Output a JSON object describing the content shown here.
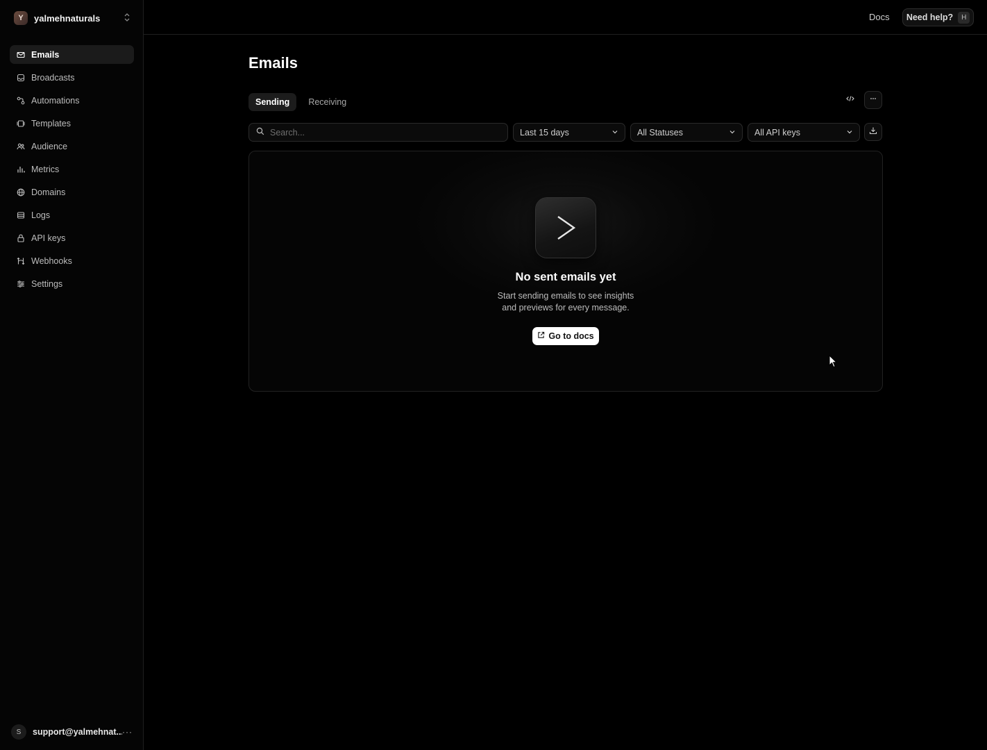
{
  "team": {
    "initial": "Y",
    "name": "yalmehnaturals"
  },
  "sidebar": {
    "items": [
      {
        "label": "Emails",
        "icon": "mail-icon",
        "active": true
      },
      {
        "label": "Broadcasts",
        "icon": "broadcast-icon",
        "active": false
      },
      {
        "label": "Automations",
        "icon": "automation-icon",
        "active": false
      },
      {
        "label": "Templates",
        "icon": "template-icon",
        "active": false
      },
      {
        "label": "Audience",
        "icon": "audience-icon",
        "active": false
      },
      {
        "label": "Metrics",
        "icon": "metrics-icon",
        "active": false
      },
      {
        "label": "Domains",
        "icon": "globe-icon",
        "active": false
      },
      {
        "label": "Logs",
        "icon": "logs-icon",
        "active": false
      },
      {
        "label": "API keys",
        "icon": "lock-icon",
        "active": false
      },
      {
        "label": "Webhooks",
        "icon": "webhook-icon",
        "active": false
      },
      {
        "label": "Settings",
        "icon": "sliders-icon",
        "active": false
      }
    ]
  },
  "user": {
    "initial": "S",
    "email": "support@yalmehnat..."
  },
  "topbar": {
    "docs_label": "Docs",
    "help_label": "Need help?",
    "help_shortcut": "H"
  },
  "main": {
    "title": "Emails",
    "tabs": [
      {
        "label": "Sending",
        "active": true
      },
      {
        "label": "Receiving",
        "active": false
      }
    ],
    "search": {
      "placeholder": "Search..."
    },
    "filters": {
      "range": "Last 15 days",
      "status": "All Statuses",
      "api_keys": "All API keys"
    },
    "empty": {
      "title": "No sent emails yet",
      "description_line1": "Start sending emails to see insights",
      "description_line2": "and previews for every message.",
      "button_label": "Go to docs"
    }
  },
  "colors": {
    "background": "#000000",
    "active_nav": "#1b1b1b",
    "primary_button": "#ffffff"
  }
}
